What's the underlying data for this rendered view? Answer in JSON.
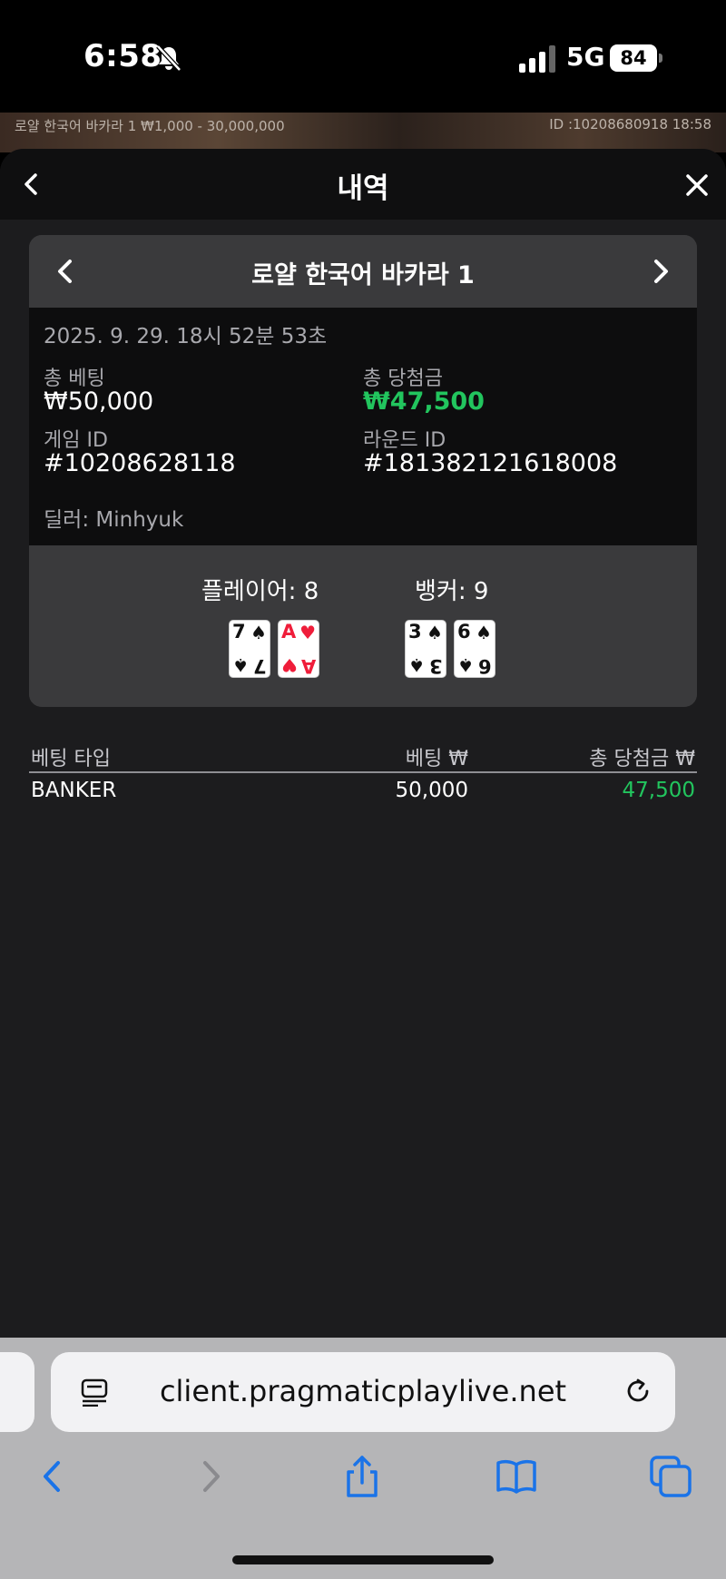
{
  "status_bar": {
    "time": "6:58",
    "network": "5G",
    "battery": "84"
  },
  "game_strip": {
    "left_text": "로얄 한국어 바카라 1 ₩1,000 - 30,000,000",
    "right_text": "ID :10208680918 18:58"
  },
  "sheet": {
    "title": "내역"
  },
  "round_card": {
    "game_name": "로얄 한국어 바카라 1",
    "date": "2025. 9. 29. 18시 52분 53초",
    "total_bet_label": "총 베팅",
    "total_bet_value": "₩50,000",
    "total_win_label": "총 당첨금",
    "total_win_value": "₩47,500",
    "game_id_label": "게임 ID",
    "game_id_value": "#10208628118",
    "round_id_label": "라운드 ID",
    "round_id_value": "#181382121618008",
    "dealer": "딜러: Minhyuk",
    "player_label": "플레이어: 8",
    "banker_label": "뱅커: 9",
    "player_cards": [
      {
        "rank": "7",
        "suit": "♠",
        "color": "black"
      },
      {
        "rank": "A",
        "suit": "♥",
        "color": "red"
      }
    ],
    "banker_cards": [
      {
        "rank": "3",
        "suit": "♠",
        "color": "black"
      },
      {
        "rank": "6",
        "suit": "♠",
        "color": "black"
      }
    ]
  },
  "bet_table": {
    "headers": [
      "베팅 타입",
      "베팅 ₩",
      "총 당첨금 ₩"
    ],
    "rows": [
      {
        "type": "BANKER",
        "bet": "50,000",
        "win": "47,500"
      }
    ]
  },
  "browser": {
    "url": "client.pragmaticplaylive.net"
  },
  "colors": {
    "win_green": "#22c55e",
    "sheet_bg": "#1c1c1e",
    "card_header": "#3a3a3c",
    "safari_blue": "#1a73e8"
  },
  "icons": [
    "bell-slash-icon",
    "signal-icon",
    "back-chevron-icon",
    "close-icon",
    "chevron-left-icon",
    "chevron-right-icon",
    "reader-icon",
    "reload-icon",
    "back-arrow-icon",
    "forward-arrow-icon",
    "share-icon",
    "bookmarks-icon",
    "tabs-icon"
  ]
}
